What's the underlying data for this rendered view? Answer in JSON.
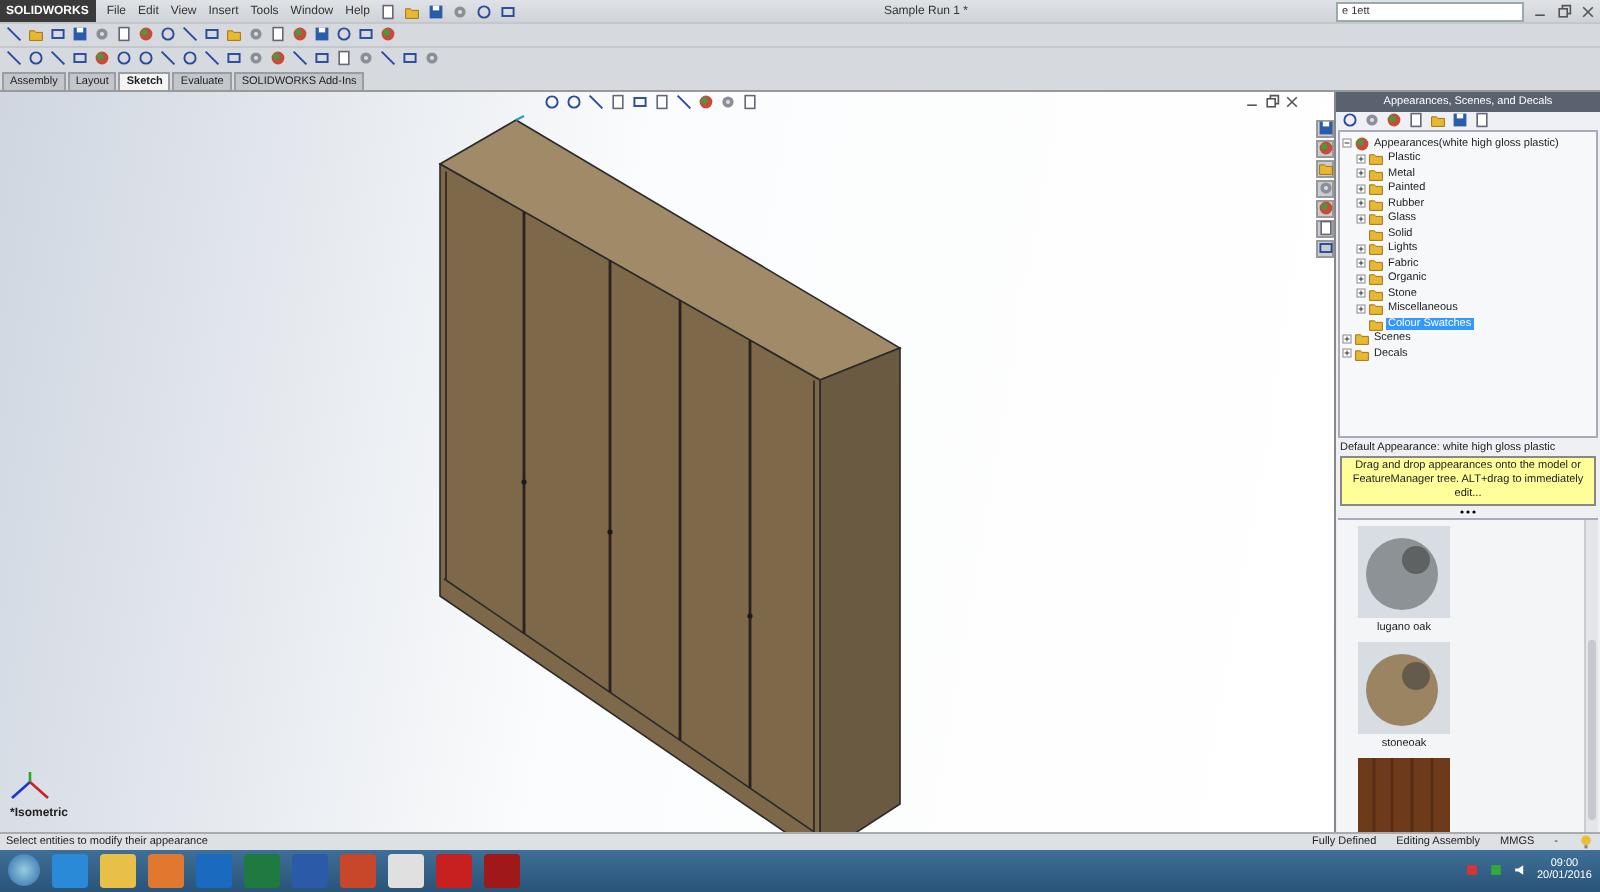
{
  "title_bar": {
    "app_name": "SOLIDWORKS",
    "menus": [
      "File",
      "Edit",
      "View",
      "Insert",
      "Tools",
      "Window",
      "Help"
    ],
    "document_title": "Sample Run 1 *",
    "search": {
      "value": "e 1ett"
    }
  },
  "command_tabs": [
    {
      "label": "Assembly",
      "selected": false
    },
    {
      "label": "Layout",
      "selected": false
    },
    {
      "label": "Sketch",
      "selected": true
    },
    {
      "label": "Evaluate",
      "selected": false
    },
    {
      "label": "SOLIDWORKS Add-Ins",
      "selected": false
    }
  ],
  "viewport": {
    "view_label": "*Isometric"
  },
  "task_pane": {
    "title": "Appearances, Scenes, and Decals",
    "tree": [
      {
        "label": "Appearances(white high gloss plastic)",
        "expanded": true,
        "selected": false,
        "children": [
          {
            "label": "Plastic",
            "expanded": false,
            "selected": false
          },
          {
            "label": "Metal",
            "expanded": false,
            "selected": false
          },
          {
            "label": "Painted",
            "expanded": false,
            "selected": false
          },
          {
            "label": "Rubber",
            "expanded": false,
            "selected": false
          },
          {
            "label": "Glass",
            "expanded": false,
            "selected": false
          },
          {
            "label": "Solid",
            "selected": false
          },
          {
            "label": "Lights",
            "expanded": false,
            "selected": false
          },
          {
            "label": "Fabric",
            "expanded": false,
            "selected": false
          },
          {
            "label": "Organic",
            "expanded": false,
            "selected": false
          },
          {
            "label": "Stone",
            "expanded": false,
            "selected": false
          },
          {
            "label": "Miscellaneous",
            "expanded": false,
            "selected": false
          },
          {
            "label": "Colour Swatches",
            "selected": true
          }
        ]
      },
      {
        "label": "Scenes",
        "expanded": false,
        "selected": false
      },
      {
        "label": "Decals",
        "expanded": false,
        "selected": false
      }
    ],
    "default_appearance": "Default Appearance: white high gloss plastic",
    "hint": "Drag and drop appearances onto the model or FeatureManager tree.  ALT+drag to immediately edit...",
    "swatches": [
      {
        "kind": "sphere",
        "label": "lugano oak",
        "color": "#8c9296"
      },
      {
        "kind": "sphere",
        "label": "stoneoak",
        "color": "#9a8462"
      },
      {
        "kind": "flat",
        "color": "#6e3a1c"
      }
    ]
  },
  "status_bar": {
    "message": "Select entities to modify their appearance",
    "state": "Fully Defined",
    "mode": "Editing Assembly",
    "units": "MMGS",
    "separator": "-"
  },
  "taskbar": {
    "time": "09:00",
    "date": "20/01/2016"
  }
}
